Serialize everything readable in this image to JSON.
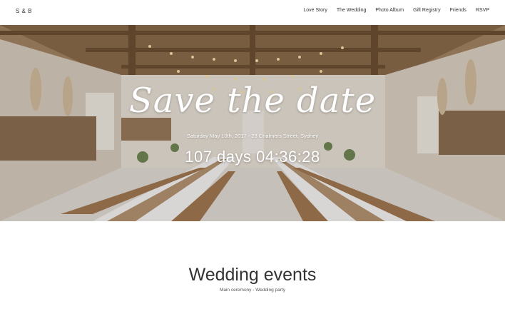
{
  "brand": "S & B",
  "nav": {
    "items": [
      "Love Story",
      "The Wedding",
      "Photo Album",
      "Gift Registry",
      "Friends",
      "RSVP"
    ]
  },
  "hero": {
    "title": "Save the date",
    "subtitle": "Saturday May 10th, 2017 - 28 Chalmers Street, Sydney",
    "countdown": "107 days 04:36:28"
  },
  "events": {
    "title": "Wedding events",
    "subtitle": "Main ceremony - Wedding party"
  },
  "colors": {
    "nav_text": "#333333",
    "hero_text": "#ffffff"
  }
}
